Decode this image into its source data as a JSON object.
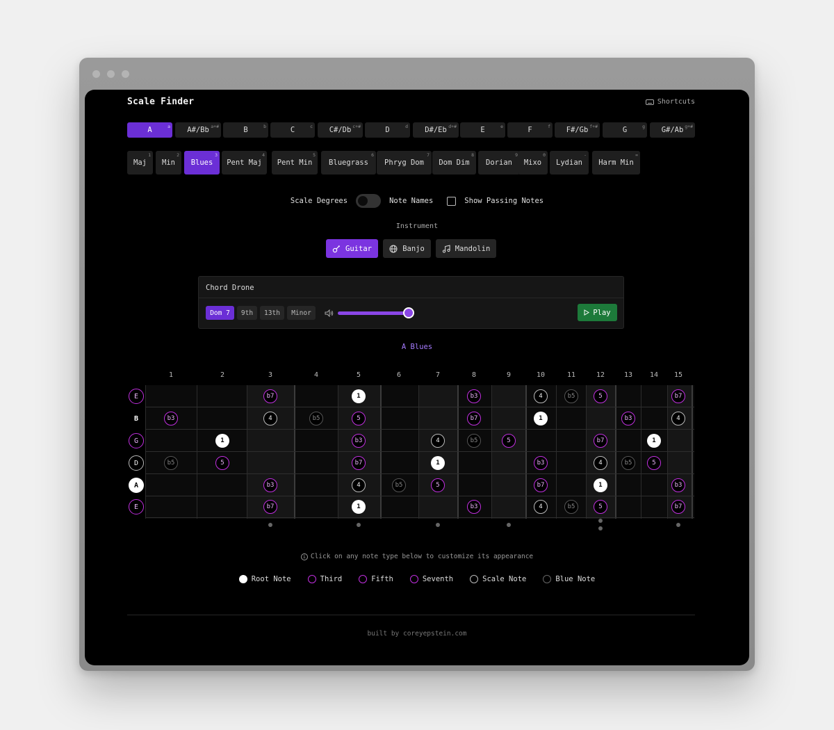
{
  "app": {
    "title": "Scale Finder",
    "shortcuts_label": "Shortcuts"
  },
  "keys": [
    {
      "label": "A",
      "hint": "a",
      "active": true
    },
    {
      "label": "A#/Bb",
      "hint": "a+#"
    },
    {
      "label": "B",
      "hint": "b"
    },
    {
      "label": "C",
      "hint": "c"
    },
    {
      "label": "C#/Db",
      "hint": "c+#"
    },
    {
      "label": "D",
      "hint": "d"
    },
    {
      "label": "D#/Eb",
      "hint": "d+#"
    },
    {
      "label": "E",
      "hint": "e"
    },
    {
      "label": "F",
      "hint": "f"
    },
    {
      "label": "F#/Gb",
      "hint": "f+#"
    },
    {
      "label": "G",
      "hint": "g"
    },
    {
      "label": "G#/Ab",
      "hint": "g+#"
    }
  ],
  "scales": [
    {
      "label": "Maj",
      "hint": "1"
    },
    {
      "label": "Min",
      "hint": "2"
    },
    {
      "label": "Blues",
      "hint": "3",
      "active": true
    },
    {
      "label": "Pent Maj",
      "hint": "4"
    },
    {
      "label": "Pent Min",
      "hint": "5"
    },
    {
      "label": "Bluegrass",
      "hint": "6"
    },
    {
      "label": "Phryg Dom",
      "hint": "7"
    },
    {
      "label": "Dom Dim",
      "hint": "8"
    },
    {
      "label": "Dorian",
      "hint": "9"
    },
    {
      "label": "Mixo",
      "hint": "0"
    },
    {
      "label": "Lydian",
      "hint": "-"
    },
    {
      "label": "Harm Min",
      "hint": "="
    }
  ],
  "display": {
    "scale_degrees_label": "Scale Degrees",
    "note_names_label": "Note Names",
    "passing_notes_label": "Show Passing Notes",
    "passing_notes_checked": false
  },
  "instrument": {
    "label": "Instrument",
    "options": [
      {
        "label": "Guitar",
        "icon": "guitar-icon",
        "active": true
      },
      {
        "label": "Banjo",
        "icon": "globe-icon"
      },
      {
        "label": "Mandolin",
        "icon": "music-note-icon"
      }
    ]
  },
  "chord_drone": {
    "title": "Chord Drone",
    "chords": [
      {
        "label": "Dom 7",
        "active": true
      },
      {
        "label": "9th"
      },
      {
        "label": "13th"
      },
      {
        "label": "Minor"
      }
    ],
    "volume": 1.0,
    "play_label": "Play"
  },
  "scale_name": "A Blues",
  "fretboard": {
    "fret_numbers": [
      "1",
      "2",
      "3",
      "4",
      "5",
      "6",
      "7",
      "8",
      "9",
      "10",
      "11",
      "12",
      "13",
      "14",
      "15"
    ],
    "open_strings": [
      {
        "label": "E",
        "type": "purple"
      },
      {
        "label": "B",
        "type": "plain"
      },
      {
        "label": "G",
        "type": "purple"
      },
      {
        "label": "D",
        "type": "white"
      },
      {
        "label": "A",
        "type": "root"
      },
      {
        "label": "E",
        "type": "purple"
      }
    ],
    "notes": [
      [
        [
          3,
          "b7",
          "purple"
        ],
        [
          5,
          "1",
          "root"
        ],
        [
          8,
          "b3",
          "purple"
        ],
        [
          10,
          "4",
          "white"
        ],
        [
          11,
          "b5",
          "grey"
        ],
        [
          12,
          "5",
          "purple"
        ],
        [
          15,
          "b7",
          "purple"
        ]
      ],
      [
        [
          1,
          "b3",
          "purple"
        ],
        [
          3,
          "4",
          "white"
        ],
        [
          4,
          "b5",
          "grey"
        ],
        [
          5,
          "5",
          "purple"
        ],
        [
          8,
          "b7",
          "purple"
        ],
        [
          10,
          "1",
          "root"
        ],
        [
          13,
          "b3",
          "purple"
        ],
        [
          15,
          "4",
          "white"
        ]
      ],
      [
        [
          2,
          "1",
          "root"
        ],
        [
          5,
          "b3",
          "purple"
        ],
        [
          7,
          "4",
          "white"
        ],
        [
          8,
          "b5",
          "grey"
        ],
        [
          9,
          "5",
          "purple"
        ],
        [
          12,
          "b7",
          "purple"
        ],
        [
          14,
          "1",
          "root"
        ]
      ],
      [
        [
          1,
          "b5",
          "grey"
        ],
        [
          2,
          "5",
          "purple"
        ],
        [
          5,
          "b7",
          "purple"
        ],
        [
          7,
          "1",
          "root"
        ],
        [
          10,
          "b3",
          "purple"
        ],
        [
          12,
          "4",
          "white"
        ],
        [
          13,
          "b5",
          "grey"
        ],
        [
          14,
          "5",
          "purple"
        ]
      ],
      [
        [
          3,
          "b3",
          "purple"
        ],
        [
          5,
          "4",
          "white"
        ],
        [
          6,
          "b5",
          "grey"
        ],
        [
          7,
          "5",
          "purple"
        ],
        [
          10,
          "b7",
          "purple"
        ],
        [
          12,
          "1",
          "root"
        ],
        [
          15,
          "b3",
          "purple"
        ]
      ],
      [
        [
          3,
          "b7",
          "purple"
        ],
        [
          5,
          "1",
          "root"
        ],
        [
          8,
          "b3",
          "purple"
        ],
        [
          10,
          "4",
          "white"
        ],
        [
          11,
          "b5",
          "grey"
        ],
        [
          12,
          "5",
          "purple"
        ],
        [
          15,
          "b7",
          "purple"
        ]
      ]
    ],
    "inlay_frets": [
      3,
      5,
      7,
      9,
      12,
      15
    ]
  },
  "hint_text": "Click on any note type below to customize its appearance",
  "legend": [
    {
      "label": "Root Note",
      "style": "root"
    },
    {
      "label": "Third",
      "style": "purple"
    },
    {
      "label": "Fifth",
      "style": "purple"
    },
    {
      "label": "Seventh",
      "style": "purple"
    },
    {
      "label": "Scale Note",
      "style": "white"
    },
    {
      "label": "Blue Note",
      "style": "grey"
    }
  ],
  "footer": "built by coreyepstein.com",
  "colors": {
    "accent": "#6b2fd6",
    "note_purple": "#c12fe0",
    "play_green": "#1d7a3a"
  }
}
